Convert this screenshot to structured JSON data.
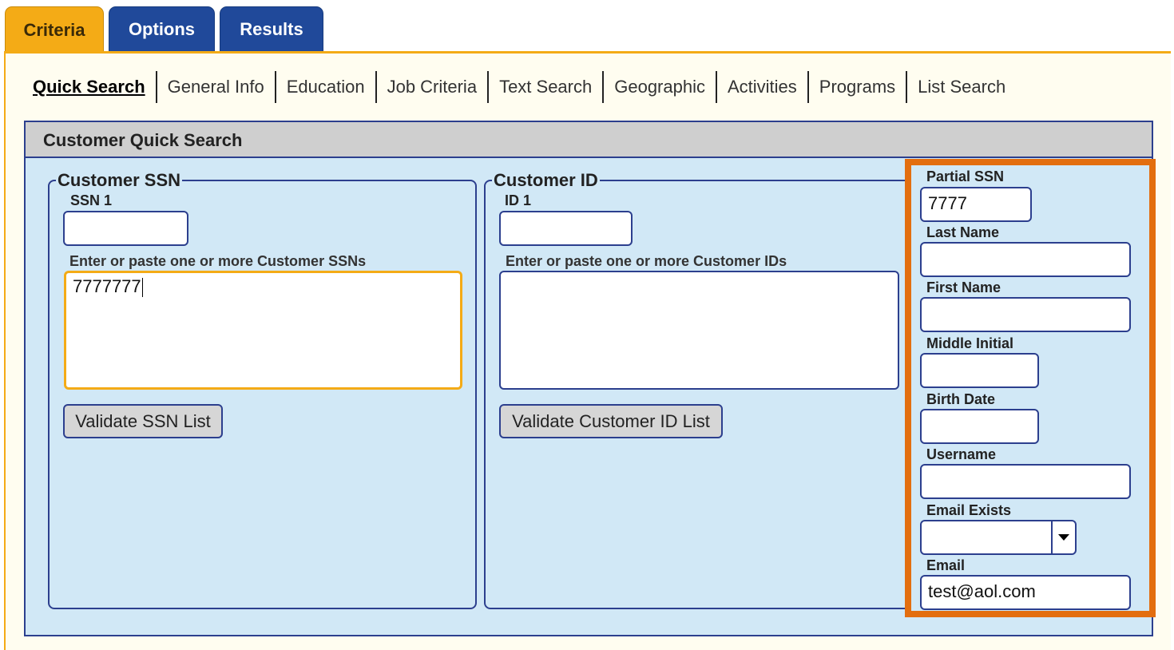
{
  "tabs": [
    {
      "label": "Criteria",
      "active": true
    },
    {
      "label": "Options",
      "active": false
    },
    {
      "label": "Results",
      "active": false
    }
  ],
  "subnav": [
    {
      "label": "Quick Search",
      "active": true
    },
    {
      "label": "General Info"
    },
    {
      "label": "Education"
    },
    {
      "label": "Job Criteria"
    },
    {
      "label": "Text Search"
    },
    {
      "label": "Geographic"
    },
    {
      "label": "Activities"
    },
    {
      "label": "Programs"
    },
    {
      "label": "List Search"
    }
  ],
  "panel": {
    "title": "Customer Quick Search"
  },
  "ssn_group": {
    "legend": "Customer SSN",
    "field_label": "SSN 1",
    "field_value": "",
    "list_hint": "Enter or paste one or more Customer SSNs",
    "list_value": "7777777",
    "validate_label": "Validate SSN List"
  },
  "id_group": {
    "legend": "Customer ID",
    "field_label": "ID 1",
    "field_value": "",
    "list_hint": "Enter or paste one or more Customer IDs",
    "list_value": "",
    "validate_label": "Validate Customer ID List"
  },
  "right_fields": {
    "partial_ssn": {
      "label": "Partial SSN",
      "value": "7777"
    },
    "last_name": {
      "label": "Last Name",
      "value": ""
    },
    "first_name": {
      "label": "First Name",
      "value": ""
    },
    "middle_initial": {
      "label": "Middle Initial",
      "value": ""
    },
    "birth_date": {
      "label": "Birth Date",
      "value": ""
    },
    "username": {
      "label": "Username",
      "value": ""
    },
    "email_exists": {
      "label": "Email Exists",
      "value": ""
    },
    "email": {
      "label": "Email",
      "value": "test@aol.com"
    }
  },
  "colors": {
    "active_tab": "#f4ab16",
    "inactive_tab": "#20499a",
    "panel_bg": "#d1e8f6",
    "highlight": "#e36e0f"
  },
  "icons": {
    "dropdown": "chevron-down-icon"
  }
}
